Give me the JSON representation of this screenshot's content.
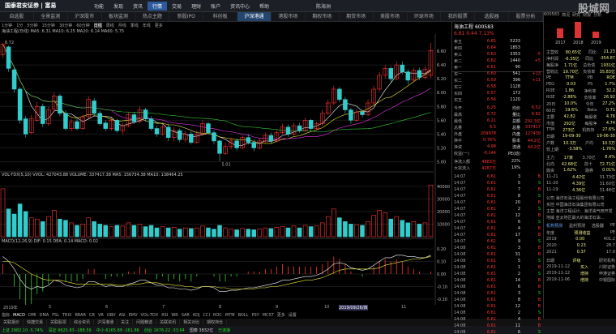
{
  "header": {
    "brand": "国泰君安证券 | 富易",
    "user": "陈海洲",
    "menus": [
      "功能",
      "发现",
      "资讯",
      "行情",
      "交易",
      "理财",
      "账户",
      "资讯中心",
      "帮助"
    ],
    "active_menu": "行情",
    "watermark": "股城网"
  },
  "tabs": [
    "自选股",
    "全景监测",
    "沪深股市",
    "板块监测",
    "热点主题",
    "新股IPO",
    "科创板",
    "沪深港通",
    "港股市场",
    "期权市场",
    "期货市场",
    "美股市场",
    "环球市场",
    "我的股票",
    "选股器",
    "股票分析"
  ],
  "active_tab": "沪深港通",
  "toolbar": {
    "periods": [
      "1分钟",
      "1分",
      "5分钟",
      "15分钟",
      "30分钟",
      "60分钟",
      "日线",
      "周线",
      "月线",
      "季线",
      "年线",
      "更多"
    ],
    "active_period": "日线",
    "title_text": "海油工程(日线) MA5: 6.31 MA10: 6.25 MA20: 6.14 MA60: 5.75",
    "top_price_label": "6.72",
    "low_label": "5.01"
  },
  "price_axis": [
    "6.60",
    "6.40",
    "6.20",
    "6.00",
    "5.80",
    "5.60",
    "5.40",
    "5.20",
    "5.00"
  ],
  "vol_label": "VOL-TDX(5,10) VVOL: 427043.88  VOLUME: 337417.38  MA5: 156734.38  MA10: 138464.25",
  "vol_axis": [
    "40000",
    "30000",
    "20000",
    "10000"
  ],
  "macd_label": "MACD(12,26,9) DIF: 0.15  DEA: 0.14  MACD: 0.02",
  "macd_axis": [
    "0.20",
    "0.10",
    "0.00",
    "-0.10",
    "-0.20"
  ],
  "xaxis": {
    "year_label": "2019年",
    "months": [
      "5",
      "6",
      "7",
      "8",
      "9",
      "10",
      "11"
    ],
    "cursor_date": "2019/09/26/四"
  },
  "indicators": [
    "指标",
    "MACD",
    "DMI",
    "DMA",
    "FSL",
    "TRIX",
    "BRAR",
    "CR",
    "VR",
    "OBV",
    "ASI",
    "EMV",
    "VOL-TDX",
    "RSI",
    "WR",
    "SAR",
    "KDJ",
    "CCI",
    "ROC",
    "MTM",
    "BOLL",
    "PSY",
    "MCST",
    "更多",
    "设置"
  ],
  "bottom_tabs": [
    "关联报价",
    "快捷交易",
    "关联股票",
    "综合资讯",
    "沪深港通",
    "关注",
    "问题精选",
    "关联资讯",
    "相关对比",
    "期权持仓"
  ],
  "status": [
    "上证 2982.10 -5.74%",
    "深证 9625.83 -188.59",
    "中小 6165.89 -161.86",
    "创业 1676.22 -33.64",
    "国泰 3832亿",
    "已连接"
  ],
  "quote": {
    "name": "海油工程",
    "code": "600583",
    "price": "6.61",
    "change": "0.44",
    "pct": "7.13%",
    "asks": [
      {
        "lvl": "卖五",
        "price": "6.65",
        "vol": "5233",
        "chg": ""
      },
      {
        "lvl": "卖四",
        "price": "6.64",
        "vol": "1853",
        "chg": ""
      },
      {
        "lvl": "卖三",
        "price": "6.63",
        "vol": "3353",
        "chg": "-5"
      },
      {
        "lvl": "卖二",
        "price": "6.62",
        "vol": "1440",
        "chg": "+5"
      },
      {
        "lvl": "卖一",
        "price": "6.61",
        "vol": "90",
        "chg": ""
      }
    ],
    "bids": [
      {
        "lvl": "买一",
        "price": "6.60",
        "vol": "541",
        "chg": "+13"
      },
      {
        "lvl": "买二",
        "price": "6.59",
        "vol": "396",
        "chg": "+11"
      },
      {
        "lvl": "买三",
        "price": "6.58",
        "vol": "1128",
        "chg": ""
      },
      {
        "lvl": "买四",
        "price": "6.57",
        "vol": "172",
        "chg": ""
      },
      {
        "lvl": "买五",
        "price": "6.56",
        "vol": "1120",
        "chg": ""
      }
    ],
    "stats": [
      [
        "今开",
        "6.25",
        "均价",
        "6.52"
      ],
      [
        "最高",
        "6.72",
        "量比",
        "6.82"
      ],
      [
        "最低",
        "6.21",
        "总额",
        "292.3亿"
      ],
      [
        "总量",
        "6.5",
        "总量",
        "337417"
      ],
      [
        "外盘",
        "209978",
        "内盘",
        "127439"
      ],
      [
        "换手",
        "0.76%",
        "股本",
        "44.2亿"
      ],
      [
        "净资",
        "4.98",
        "流通",
        "44.2亿"
      ],
      [
        "收益(一)",
        "-0.144",
        "PE(动)",
        ""
      ]
    ],
    "flow": [
      [
        "净流入额",
        "4883万",
        "22%"
      ],
      [
        "大宗流入",
        "4287万",
        "19%"
      ]
    ],
    "ticks": [
      [
        "14:07",
        "6.61",
        "3",
        "B"
      ],
      [
        "14:07",
        "6.61",
        "5",
        "S"
      ],
      [
        "14:07",
        "6.61",
        "7",
        "B"
      ],
      [
        "14:07",
        "6.61",
        "8",
        "S"
      ],
      [
        "14:07",
        "6.61",
        "20",
        "B"
      ],
      [
        "14:07",
        "6.61",
        "2",
        "S"
      ],
      [
        "14:07",
        "6.61",
        "12",
        "B"
      ],
      [
        "14:07",
        "6.61",
        "6",
        "S"
      ],
      [
        "14:07",
        "6.61",
        "4",
        "B"
      ],
      [
        "14:07",
        "6.61",
        "17",
        "B"
      ],
      [
        "14:07",
        "6.61",
        "9",
        "S"
      ],
      [
        "14:08",
        "6.61",
        "3",
        "B"
      ],
      [
        "14:08",
        "6.61",
        "31",
        "B"
      ],
      [
        "14:08",
        "6.61",
        "5",
        "S"
      ],
      [
        "14:08",
        "6.61",
        "1",
        "B"
      ],
      [
        "14:08",
        "6.61",
        "2",
        "S"
      ],
      [
        "14:08",
        "6.61",
        "14",
        "B"
      ],
      [
        "14:08",
        "6.61",
        "6",
        "B"
      ],
      [
        "14:08",
        "6.61",
        "3",
        "S"
      ],
      [
        "14:08",
        "6.61",
        "8",
        "B"
      ],
      [
        "14:08",
        "6.61",
        "12",
        "B"
      ],
      [
        "14:08",
        "6.61",
        "2",
        "S"
      ],
      [
        "14:08",
        "6.61",
        "4",
        "B"
      ],
      [
        "14:08",
        "6.61",
        "11",
        "B"
      ],
      [
        "14:08",
        "6.61",
        "6",
        "S"
      ],
      [
        "14:08",
        "6.61",
        "3",
        "B"
      ]
    ]
  },
  "f10": {
    "code": "600583",
    "tabs": [
      "简况",
      "研究",
      "财报",
      "分析"
    ],
    "chart_years": [
      "2017",
      "2018",
      "2019"
    ],
    "rows": [
      [
        "主营收",
        "80.65亿",
        "同比",
        "21.23"
      ],
      [
        "净利润",
        "-6.35亿",
        "同比",
        "-354.87"
      ],
      [
        "每股净",
        "1.71亿",
        "总负债",
        "1931亿"
      ],
      [
        "营收比",
        "19.70亿",
        "负债率",
        "35.83亿"
      ],
      [
        "PE",
        "TTM",
        "PB",
        "ROE"
      ],
      [
        "PEG",
        "0.03",
        "PS",
        "1.7%"
      ],
      [
        "ROE",
        "1.86",
        "净利率",
        "32.2"
      ],
      [
        "ROE",
        "-2.88%",
        "负债率",
        "26.92"
      ],
      [
        "20日",
        "10.0%",
        "今年",
        "27.2%"
      ],
      [
        "60日",
        "19.6%",
        "Beta",
        "0.71"
      ],
      [
        "主要",
        "42.82",
        "每股收",
        "4.76"
      ],
      [
        "市值",
        "292亿",
        "每股净",
        "4.74"
      ],
      [
        "TTM",
        "273亿",
        "机构持",
        "27.6%"
      ],
      [
        "日期",
        "19-09-30",
        "",
        "19-06-30"
      ],
      [
        "户数",
        "10.3万",
        "户均",
        "10.3万"
      ],
      [
        "较上期",
        "-3.58%",
        "",
        "-1.76%"
      ]
    ],
    "flow_rows": [
      [
        "主力",
        "17家",
        "3.70亿",
        "8.4%"
      ],
      [
        "北向",
        "42.68亿",
        "前十",
        "72.71亿"
      ],
      [
        "融资",
        "1.62%",
        "融券",
        "0.01%"
      ]
    ],
    "dates": [
      [
        "11-21",
        "4.42亿",
        "31.73亿"
      ],
      [
        "11-20",
        "4.39亿",
        "31.60亿"
      ],
      [
        "11-19",
        "4.36亿",
        "31.48亿"
      ]
    ],
    "company": [
      "公司 海洋石油工程股份有限公司",
      "实控 中国海洋石油集团有限公司",
      "主营 海洋工程设计、海洋油气田开发",
      "地域 亚太地区最大的海洋石油..."
    ],
    "forecast_tabs": [
      "机构预测",
      "盈利预测",
      "选股器",
      "PE"
    ],
    "forecast": [
      [
        "年度",
        "预测收益",
        "PE"
      ],
      [
        "2019",
        "0.00",
        "401.2"
      ],
      [
        "2020",
        "0.23",
        "28.7"
      ],
      [
        "2021",
        "0.37",
        "17.9"
      ]
    ],
    "ratings": [
      [
        "日期",
        "评级",
        "研究机构"
      ],
      [
        "2019-11-12",
        "买入",
        "川财证券"
      ],
      [
        "2019-11-12",
        "增持",
        "申港证券"
      ],
      [
        "2019-11-06",
        "增持",
        "中银国际"
      ]
    ]
  },
  "chart_data": [
    {
      "type": "candlestick",
      "title": "海油工程(日线)",
      "ylim": [
        4.9,
        6.8
      ],
      "candles": [
        [
          6.55,
          6.7,
          6.72,
          6.5
        ],
        [
          6.66,
          6.35,
          6.68,
          6.3
        ],
        [
          6.33,
          6.05,
          6.36,
          6.0
        ],
        [
          6.05,
          5.6,
          6.08,
          5.55
        ],
        [
          5.62,
          5.4,
          5.66,
          5.35
        ],
        [
          5.42,
          5.62,
          5.68,
          5.4
        ],
        [
          5.6,
          5.8,
          5.86,
          5.58
        ],
        [
          5.8,
          5.55,
          5.84,
          5.5
        ],
        [
          5.55,
          5.75,
          5.8,
          5.52
        ],
        [
          5.76,
          5.95,
          6.0,
          5.72
        ],
        [
          5.95,
          5.7,
          5.98,
          5.66
        ],
        [
          5.7,
          5.48,
          5.74,
          5.45
        ],
        [
          5.48,
          5.58,
          5.62,
          5.44
        ],
        [
          5.58,
          5.48,
          5.62,
          5.45
        ],
        [
          5.48,
          5.65,
          5.68,
          5.46
        ],
        [
          5.65,
          5.9,
          5.95,
          5.62
        ],
        [
          5.88,
          5.7,
          5.92,
          5.66
        ],
        [
          5.7,
          5.55,
          5.74,
          5.52
        ],
        [
          5.56,
          5.48,
          5.6,
          5.44
        ],
        [
          5.48,
          5.6,
          5.64,
          5.45
        ],
        [
          5.6,
          5.45,
          5.62,
          5.42
        ],
        [
          5.45,
          5.52,
          5.56,
          5.4
        ],
        [
          5.52,
          5.68,
          5.72,
          5.5
        ],
        [
          5.68,
          5.58,
          5.72,
          5.55
        ],
        [
          5.58,
          5.75,
          5.8,
          5.56
        ],
        [
          5.75,
          5.62,
          5.78,
          5.58
        ],
        [
          5.62,
          5.48,
          5.66,
          5.45
        ],
        [
          5.48,
          5.4,
          5.52,
          5.36
        ],
        [
          5.4,
          5.5,
          5.54,
          5.38
        ],
        [
          5.5,
          5.35,
          5.55,
          5.3
        ],
        [
          5.35,
          5.45,
          5.5,
          5.3
        ],
        [
          5.45,
          5.32,
          5.48,
          5.28
        ],
        [
          5.32,
          5.4,
          5.44,
          5.28
        ],
        [
          5.4,
          5.28,
          5.44,
          5.25
        ],
        [
          5.28,
          5.4,
          5.45,
          5.26
        ],
        [
          5.4,
          5.55,
          5.6,
          5.38
        ],
        [
          5.55,
          5.42,
          5.58,
          5.4
        ],
        [
          5.42,
          5.3,
          5.45,
          5.25
        ],
        [
          5.3,
          5.12,
          5.32,
          5.01
        ],
        [
          5.12,
          5.22,
          5.28,
          5.1
        ],
        [
          5.22,
          5.3,
          5.35,
          5.18
        ],
        [
          5.3,
          5.2,
          5.34,
          5.16
        ],
        [
          5.2,
          5.35,
          5.38,
          5.18
        ],
        [
          5.35,
          5.28,
          5.4,
          5.25
        ],
        [
          5.28,
          5.2,
          5.32,
          5.15
        ],
        [
          5.2,
          5.3,
          5.34,
          5.18
        ],
        [
          5.3,
          5.38,
          5.42,
          5.26
        ],
        [
          5.38,
          5.3,
          5.42,
          5.27
        ],
        [
          5.3,
          5.42,
          5.46,
          5.28
        ],
        [
          5.42,
          5.5,
          5.55,
          5.4
        ],
        [
          5.5,
          5.4,
          5.54,
          5.36
        ],
        [
          5.4,
          5.52,
          5.56,
          5.38
        ],
        [
          5.52,
          5.45,
          5.56,
          5.42
        ],
        [
          5.45,
          5.6,
          5.64,
          5.44
        ],
        [
          5.6,
          5.48,
          5.62,
          5.45
        ],
        [
          5.48,
          5.55,
          5.58,
          5.45
        ],
        [
          5.55,
          5.7,
          5.75,
          5.52
        ],
        [
          5.7,
          5.85,
          5.9,
          5.68
        ],
        [
          5.85,
          6.05,
          6.1,
          5.82
        ],
        [
          6.05,
          5.9,
          6.08,
          5.86
        ],
        [
          5.9,
          5.75,
          5.94,
          5.7
        ],
        [
          5.75,
          5.6,
          5.78,
          5.55
        ],
        [
          5.6,
          5.72,
          5.76,
          5.58
        ],
        [
          5.72,
          5.68,
          5.76,
          5.64
        ],
        [
          5.68,
          5.85,
          5.9,
          5.66
        ],
        [
          5.85,
          6.05,
          6.1,
          5.82
        ],
        [
          6.05,
          6.25,
          6.3,
          6.02
        ],
        [
          6.25,
          6.35,
          6.4,
          6.2
        ],
        [
          6.35,
          6.2,
          6.38,
          6.15
        ],
        [
          6.2,
          6.4,
          6.45,
          6.18
        ],
        [
          6.4,
          6.3,
          6.45,
          6.26
        ],
        [
          6.3,
          6.18,
          6.34,
          6.12
        ],
        [
          6.18,
          6.32,
          6.36,
          6.15
        ],
        [
          6.32,
          6.22,
          6.36,
          6.18
        ],
        [
          6.22,
          6.34,
          6.38,
          6.2
        ],
        [
          6.25,
          6.61,
          6.72,
          6.21
        ]
      ]
    },
    {
      "type": "bar",
      "title": "VOL-TDX(5,10)",
      "ylim": [
        0,
        45000
      ],
      "values": [
        38000,
        22000,
        18000,
        26000,
        20000,
        15000,
        14000,
        12000,
        16000,
        21000,
        14000,
        13000,
        11000,
        9000,
        10000,
        15000,
        12000,
        10000,
        9000,
        8000,
        9000,
        8500,
        11000,
        9000,
        10000,
        8000,
        9000,
        7000,
        8000,
        7000,
        7500,
        6000,
        7000,
        6500,
        7000,
        8500,
        7000,
        6000,
        9000,
        7000,
        6000,
        5500,
        6500,
        6000,
        5500,
        6000,
        7000,
        6500,
        7500,
        8000,
        7000,
        8500,
        7000,
        9000,
        8000,
        8500,
        11000,
        16000,
        22000,
        15000,
        12000,
        10000,
        9500,
        9000,
        12000,
        17000,
        21000,
        19000,
        14000,
        16000,
        13000,
        11000,
        12000,
        10000,
        11000,
        41000
      ]
    },
    {
      "type": "line",
      "title": "MACD(12,26,9)",
      "ylim": [
        -0.22,
        0.22
      ],
      "series": [
        {
          "name": "DIF",
          "values": [
            0.14,
            0.1,
            0.04,
            -0.04,
            -0.1,
            -0.12,
            -0.1,
            -0.11,
            -0.09,
            -0.05,
            -0.06,
            -0.09,
            -0.1,
            -0.11,
            -0.1,
            -0.06,
            -0.06,
            -0.08,
            -0.1,
            -0.09,
            -0.1,
            -0.1,
            -0.08,
            -0.07,
            -0.05,
            -0.05,
            -0.07,
            -0.09,
            -0.09,
            -0.11,
            -0.11,
            -0.12,
            -0.12,
            -0.13,
            -0.12,
            -0.1,
            -0.1,
            -0.11,
            -0.14,
            -0.14,
            -0.13,
            -0.13,
            -0.12,
            -0.11,
            -0.11,
            -0.1,
            -0.09,
            -0.08,
            -0.07,
            -0.05,
            -0.05,
            -0.04,
            -0.03,
            -0.02,
            -0.02,
            -0.01,
            0.01,
            0.04,
            0.08,
            0.09,
            0.08,
            0.05,
            0.04,
            0.03,
            0.04,
            0.07,
            0.1,
            0.13,
            0.13,
            0.15,
            0.15,
            0.14,
            0.14,
            0.13,
            0.13,
            0.15
          ]
        },
        {
          "name": "DEA",
          "values": [
            0.1,
            0.1,
            0.09,
            0.06,
            0.03,
            0.0,
            -0.02,
            -0.04,
            -0.05,
            -0.05,
            -0.05,
            -0.06,
            -0.07,
            -0.08,
            -0.08,
            -0.08,
            -0.08,
            -0.08,
            -0.08,
            -0.08,
            -0.09,
            -0.09,
            -0.09,
            -0.08,
            -0.08,
            -0.07,
            -0.07,
            -0.07,
            -0.08,
            -0.08,
            -0.09,
            -0.09,
            -0.1,
            -0.1,
            -0.11,
            -0.1,
            -0.1,
            -0.1,
            -0.11,
            -0.11,
            -0.12,
            -0.12,
            -0.12,
            -0.12,
            -0.12,
            -0.11,
            -0.11,
            -0.1,
            -0.1,
            -0.09,
            -0.08,
            -0.07,
            -0.06,
            -0.05,
            -0.05,
            -0.04,
            -0.03,
            -0.01,
            0.01,
            0.03,
            0.04,
            0.04,
            0.04,
            0.04,
            0.04,
            0.04,
            0.05,
            0.07,
            0.08,
            0.09,
            0.1,
            0.11,
            0.12,
            0.12,
            0.13,
            0.14
          ]
        }
      ]
    }
  ]
}
